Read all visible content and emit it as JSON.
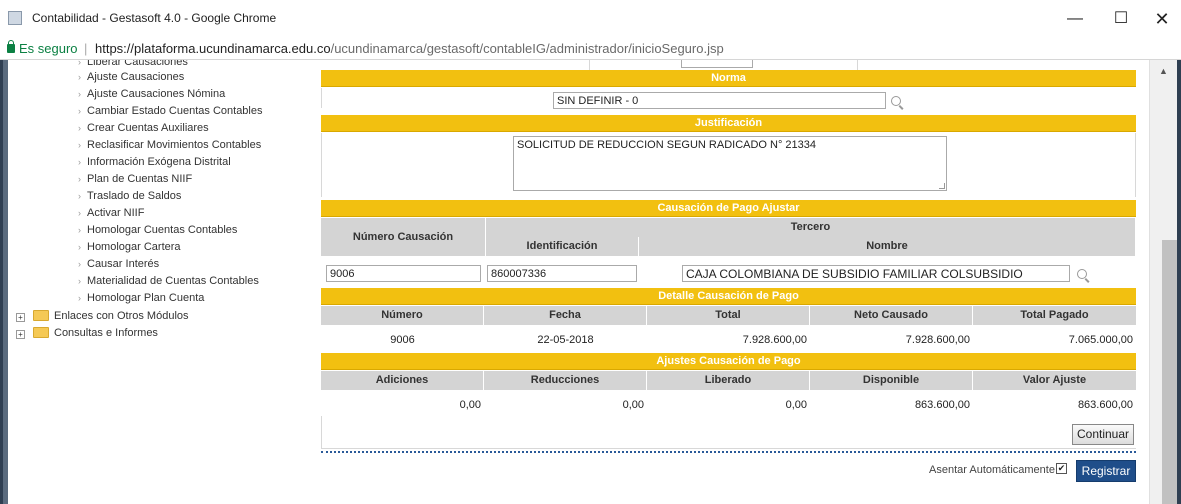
{
  "window": {
    "title": "Contabilidad - Gestasoft 4.0 - Google Chrome",
    "minimize": "—",
    "maximize": "☐",
    "close": "✕"
  },
  "address": {
    "secure_label": "Es seguro",
    "separator": "|",
    "url_host": "https://plataforma.ucundinamarca.edu.co",
    "url_path": "/ucundinamarca/gestasoft/contableIG/administrador/inicioSeguro.jsp"
  },
  "sidebar": {
    "items": [
      "Liberar Causaciones",
      "Ajuste Causaciones",
      "Ajuste Causaciones Nómina",
      "Cambiar Estado Cuentas Contables",
      "Crear Cuentas Auxiliares",
      "Reclasificar Movimientos Contables",
      "Información Exógena Distrital",
      "Plan de Cuentas NIIF",
      "Traslado de Saldos",
      "Activar NIIF",
      "Homologar Cuentas Contables",
      "Homologar Cartera",
      "Causar Interés",
      "Materialidad de Cuentas Contables",
      "Homologar Plan Cuenta"
    ],
    "folders": [
      {
        "expander": "+",
        "label": "Enlaces con Otros Módulos"
      },
      {
        "expander": "+",
        "label": "Consultas e Informes"
      }
    ]
  },
  "form": {
    "norma": {
      "header": "Norma",
      "value": "SIN DEFINIR - 0"
    },
    "justificacion": {
      "header": "Justificación",
      "value": "SOLICITUD DE REDUCCION SEGUN RADICADO N° 21334"
    },
    "causacion": {
      "header": "Causación de Pago Ajustar",
      "numero_label": "Número Causación",
      "tercero_label": "Tercero",
      "identificacion_label": "Identificación",
      "nombre_label": "Nombre",
      "numero_value": "9006",
      "identificacion_value": "860007336",
      "nombre_value": "CAJA COLOMBIANA DE SUBSIDIO FAMILIAR COLSUBSIDIO"
    },
    "detalle": {
      "header": "Detalle Causación de Pago",
      "columns": [
        "Número",
        "Fecha",
        "Total",
        "Neto Causado",
        "Total Pagado"
      ],
      "row": [
        "9006",
        "22-05-2018",
        "7.928.600,00",
        "7.928.600,00",
        "7.065.000,00"
      ]
    },
    "ajustes": {
      "header": "Ajustes Causación de Pago",
      "columns": [
        "Adiciones",
        "Reducciones",
        "Liberado",
        "Disponible",
        "Valor Ajuste"
      ],
      "row": [
        "0,00",
        "0,00",
        "0,00",
        "863.600,00",
        "863.600,00"
      ]
    },
    "continuar_label": "Continuar",
    "asentar_label": "Asentar Automáticamente.",
    "asentar_checked": "✔",
    "registrar_label": "Registrar"
  },
  "icons": {
    "lens": "search-icon",
    "folder": "folder-icon",
    "lock": "lock-icon"
  },
  "colors": {
    "section_header": "#f2c010",
    "column_header": "#d4d4d4",
    "primary_button": "#1f4e8a",
    "secure_green": "#0b8043"
  }
}
